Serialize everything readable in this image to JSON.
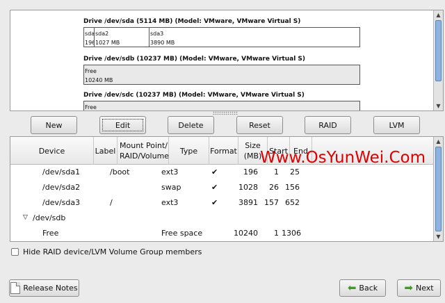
{
  "drives": [
    {
      "title": "Drive /dev/sda (5114 MB) (Model: VMware, VMware Virtual S)",
      "partitions": [
        {
          "name": "sda",
          "size": "196"
        },
        {
          "name": "sda2",
          "size": "1027 MB"
        },
        {
          "name": "sda3",
          "size": "3890 MB"
        }
      ]
    },
    {
      "title": "Drive /dev/sdb (10237 MB) (Model: VMware, VMware Virtual S)",
      "partitions": [
        {
          "name": "Free",
          "size": "10240 MB"
        }
      ]
    },
    {
      "title": "Drive /dev/sdc (10237 MB) (Model: VMware, VMware Virtual S)",
      "partitions": [
        {
          "name": "Free",
          "size": ""
        }
      ]
    }
  ],
  "buttons": {
    "new": "New",
    "edit": "Edit",
    "delete": "Delete",
    "reset": "Reset",
    "raid": "RAID",
    "lvm": "LVM"
  },
  "table": {
    "headers": {
      "device": "Device",
      "label": "Label",
      "mount1": "Mount Point/",
      "mount2": "RAID/Volume",
      "type": "Type",
      "format": "Format",
      "size1": "Size",
      "size2": "(MB)",
      "start": "Start",
      "end": "End"
    },
    "rows": [
      {
        "device": "/dev/sda1",
        "label": "",
        "mount": "/boot",
        "type": "ext3",
        "format": "✔",
        "size": "196",
        "start": "1",
        "end": "25"
      },
      {
        "device": "/dev/sda2",
        "label": "",
        "mount": "",
        "type": "swap",
        "format": "✔",
        "size": "1028",
        "start": "26",
        "end": "156"
      },
      {
        "device": "/dev/sda3",
        "label": "",
        "mount": "/",
        "type": "ext3",
        "format": "✔",
        "size": "3891",
        "start": "157",
        "end": "652"
      },
      {
        "device": "/dev/sdb",
        "label": "",
        "mount": "",
        "type": "",
        "format": "",
        "size": "",
        "start": "",
        "end": ""
      },
      {
        "device": "Free",
        "label": "",
        "mount": "",
        "type": "Free space",
        "format": "",
        "size": "10240",
        "start": "1",
        "end": "1306"
      }
    ]
  },
  "hide_checkbox_label": "Hide RAID device/LVM Volume Group members",
  "footer": {
    "release_notes": "Release Notes",
    "back": "Back",
    "next": "Next"
  },
  "watermark": "Www.OsYunWei.Com",
  "colors": {
    "accent": "#8fb2de",
    "watermark": "#e00000",
    "arrow": "#3f9b22"
  }
}
